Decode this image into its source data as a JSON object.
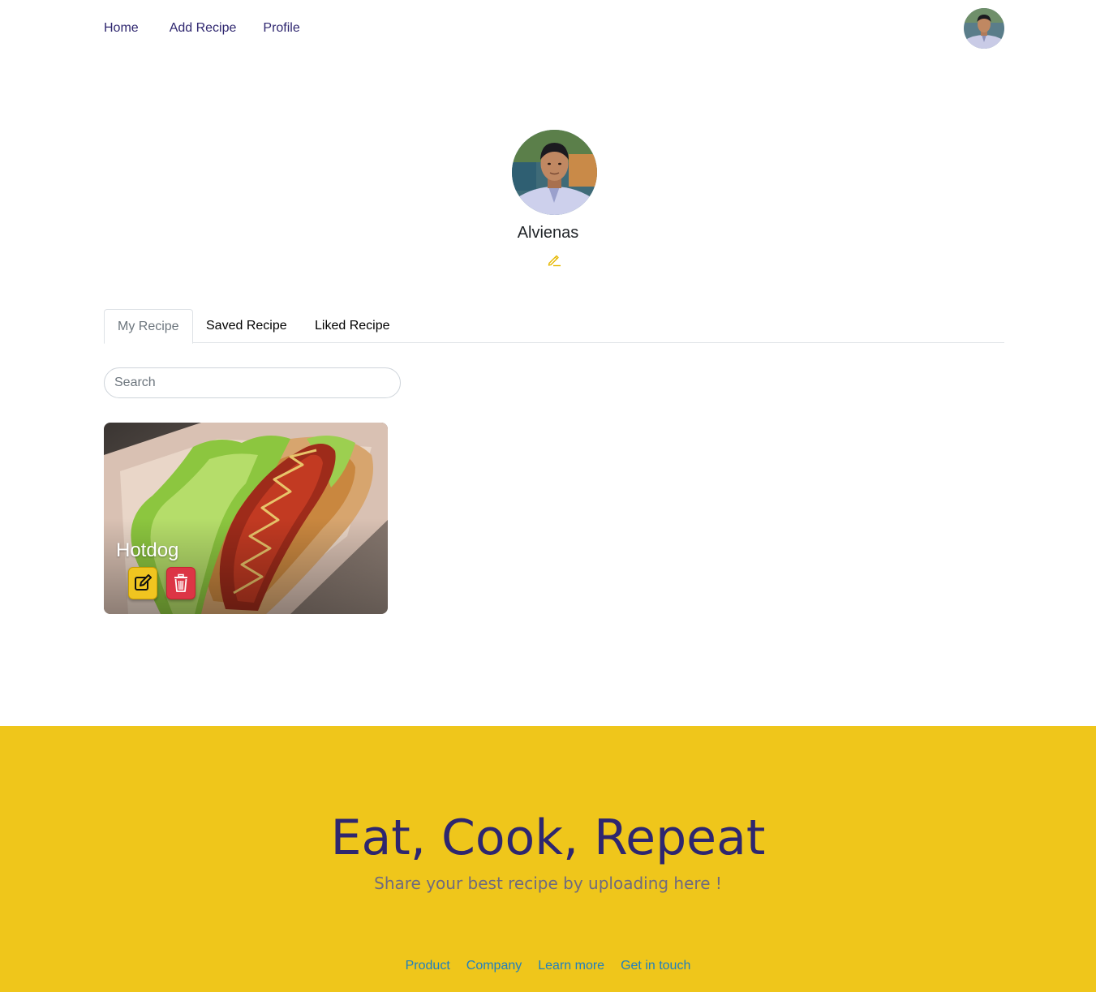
{
  "nav": {
    "links": [
      "Home",
      "Add Recipe",
      "Profile"
    ],
    "avatar_icon": "user-avatar"
  },
  "profile": {
    "name": "Alvienas",
    "edit_icon": "pencil-icon"
  },
  "tabs": [
    "My Recipe",
    "Saved Recipe",
    "Liked Recipe"
  ],
  "search": {
    "placeholder": "Search",
    "value": ""
  },
  "recipes": [
    {
      "title": "Hotdog",
      "edit_icon": "edit-icon",
      "delete_icon": "trash-icon"
    }
  ],
  "footer": {
    "title": "Eat, Cook, Repeat",
    "subtitle": "Share your best recipe by uploading here !",
    "links": [
      "Product",
      "Company",
      "Learn more",
      "Get in touch"
    ]
  },
  "colors": {
    "nav_text": "#2e266f",
    "accent_yellow": "#efc61b",
    "delete_red": "#dc3545",
    "footer_link": "#1e7fc0"
  }
}
